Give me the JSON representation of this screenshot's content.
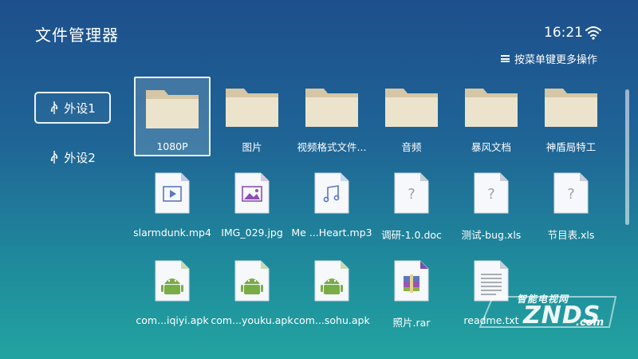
{
  "header": {
    "title": "文件管理器",
    "time": "16:21",
    "menu_hint": "按菜单键更多操作"
  },
  "sidebar": {
    "items": [
      {
        "label": "外设1",
        "active": true
      },
      {
        "label": "外设2",
        "active": false
      }
    ]
  },
  "colors": {
    "folder_body": "#ece3cd",
    "folder_tab": "#d5c6a5",
    "doc_blue": "#5e77bd",
    "doc_purple": "#8e4fb5",
    "doc_gray": "#9aa3ad",
    "android": "#78ad46"
  },
  "files": [
    {
      "name": "1080P",
      "type": "folder",
      "icon": "folder-icon"
    },
    {
      "name": "图片",
      "type": "folder",
      "icon": "folder-icon"
    },
    {
      "name": "视频格式文件...",
      "type": "folder",
      "icon": "folder-icon"
    },
    {
      "name": "音频",
      "type": "folder",
      "icon": "folder-icon"
    },
    {
      "name": "暴风文档",
      "type": "folder",
      "icon": "folder-icon"
    },
    {
      "name": "神盾局特工",
      "type": "folder",
      "icon": "folder-icon"
    },
    {
      "name": "slarmdunk.mp4",
      "type": "video",
      "icon": "video-file-icon"
    },
    {
      "name": "IMG_029.jpg",
      "type": "image",
      "icon": "image-file-icon"
    },
    {
      "name": "Me ...Heart.mp3",
      "type": "audio",
      "icon": "audio-file-icon"
    },
    {
      "name": "调研-1.0.doc",
      "type": "unknown",
      "icon": "unknown-file-icon"
    },
    {
      "name": "测试-bug.xls",
      "type": "unknown",
      "icon": "unknown-file-icon"
    },
    {
      "name": "节目表.xls",
      "type": "unknown",
      "icon": "unknown-file-icon"
    },
    {
      "name": "com...iqiyi.apk",
      "type": "apk",
      "icon": "android-apk-icon"
    },
    {
      "name": "com...youku.apk",
      "type": "apk",
      "icon": "android-apk-icon"
    },
    {
      "name": "com...sohu.apk",
      "type": "apk",
      "icon": "android-apk-icon"
    },
    {
      "name": "照片.rar",
      "type": "archive",
      "icon": "archive-file-icon"
    },
    {
      "name": "readme.txt",
      "type": "text",
      "icon": "text-file-icon"
    }
  ],
  "watermark": {
    "cn": "智能电视网",
    "en": "ZNDS",
    "suffix": ".com"
  }
}
